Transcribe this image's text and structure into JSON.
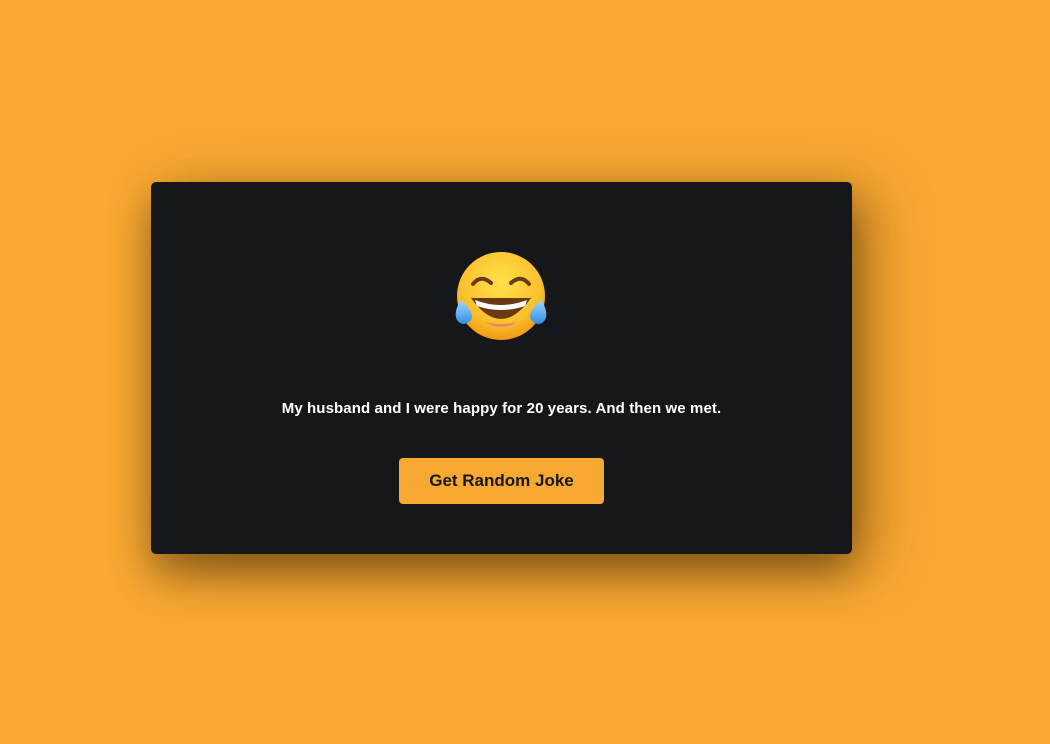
{
  "card": {
    "emoji_icon": "face-with-tears-of-joy-icon",
    "joke_text": "My husband and I were happy for 20 years. And then we met.",
    "button_label": "Get Random Joke"
  },
  "colors": {
    "background": "#f8a931",
    "card": "#16171b",
    "button": "#f8a931",
    "button_text": "#16171b",
    "joke_text": "#ffffff"
  }
}
